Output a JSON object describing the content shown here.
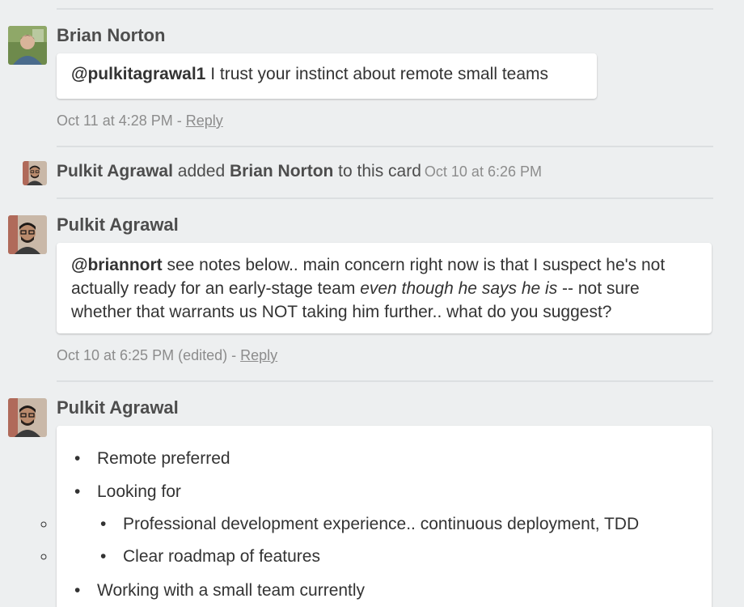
{
  "comments": [
    {
      "author": "Brian Norton",
      "mention": "@pulkitagrawal1",
      "text": " I trust your instinct about remote small teams",
      "timestamp": "Oct 11 at 4:28 PM",
      "separator": " - ",
      "reply_label": "Reply"
    },
    {
      "author": "Pulkit Agrawal",
      "mention": "@briannort",
      "text_part1": " see notes below.. main concern right now is that I suspect he's not actually ready for an early-stage team ",
      "text_italic": "even though he says he is",
      "text_part2": " -- not sure whether that warrants us NOT taking him further.. what do you suggest?",
      "timestamp": "Oct 10 at 6:25 PM (edited)",
      "separator": " - ",
      "reply_label": "Reply"
    },
    {
      "author": "Pulkit Agrawal",
      "notes": [
        {
          "text": "Remote preferred"
        },
        {
          "text": "Looking for",
          "children": [
            "Professional development experience.. continuous deployment, TDD",
            "Clear roadmap of features"
          ]
        },
        {
          "text": "Working with a small team currently"
        }
      ]
    }
  ],
  "activity": {
    "actor": "Pulkit Agrawal",
    "verb": " added ",
    "target": "Brian Norton",
    "suffix": " to this card",
    "timestamp": "Oct 10 at 6:26 PM"
  },
  "bullet_glyph": "•",
  "colors": {
    "background": "#edeff0",
    "card": "#ffffff",
    "text": "#333333",
    "meta": "#8c8c8c"
  }
}
